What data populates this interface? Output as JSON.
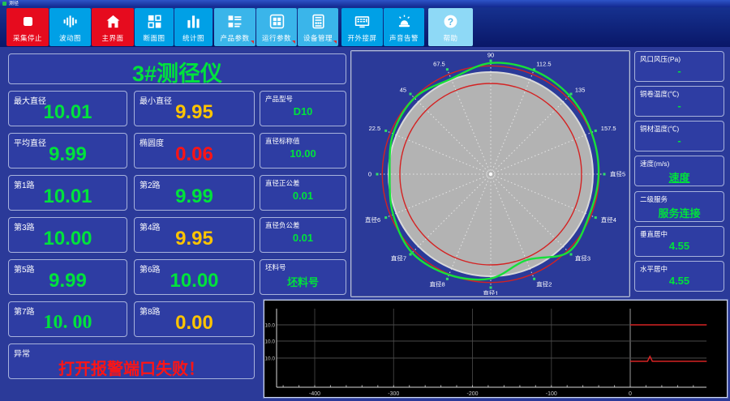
{
  "window": {
    "title": "测径"
  },
  "colors": {
    "accent_green": "#00e23c",
    "warn_yellow": "#ffc400",
    "alarm_red": "#ff1414",
    "button_red": "#e60b1e",
    "button_blue": "#00a0e6",
    "button_light": "#3ab5ea",
    "button_pale": "#8ed9f6",
    "profile_green": "#17e03a",
    "tolerance_red": "#d42222",
    "disc_gray": "#b3b3b3"
  },
  "toolbar": {
    "buttons": [
      {
        "label": "采集停止",
        "icon": "stop-icon",
        "style": "red",
        "corner": false
      },
      {
        "label": "波动图",
        "icon": "waveform-icon",
        "style": "blue",
        "corner": false
      },
      {
        "label": "主界面",
        "icon": "home-icon",
        "style": "red",
        "corner": false
      },
      {
        "label": "断面图",
        "icon": "sections-icon",
        "style": "blue",
        "corner": false
      },
      {
        "label": "统计图",
        "icon": "barchart-icon",
        "style": "blue",
        "corner": false
      },
      {
        "label": "产品参数",
        "icon": "product-params-icon",
        "style": "light",
        "corner": true
      },
      {
        "label": "运行参数",
        "icon": "run-params-icon",
        "style": "light",
        "corner": true
      },
      {
        "label": "设备管理",
        "icon": "device-manage-icon",
        "style": "light",
        "corner": true
      },
      {
        "label": "开外接屏",
        "icon": "external-screen-icon",
        "style": "blue",
        "corner": false
      },
      {
        "label": "声音告警",
        "icon": "sound-alarm-icon",
        "style": "blue",
        "corner": false
      },
      {
        "label": "帮助",
        "icon": "help-icon",
        "style": "pale",
        "corner": false
      }
    ]
  },
  "header": {
    "title": "3#测径仪"
  },
  "measurements": {
    "cells": [
      {
        "label": "最大直径",
        "value": "10.01",
        "color": "green",
        "col": "a",
        "row": 0
      },
      {
        "label": "最小直径",
        "value": "9.95",
        "color": "yellow",
        "col": "b",
        "row": 0
      },
      {
        "label": "产品型号",
        "value": "D10",
        "color": "green",
        "col": "c",
        "row": 0
      },
      {
        "label": "平均直径",
        "value": "9.99",
        "color": "green",
        "col": "a",
        "row": 1
      },
      {
        "label": "椭圆度",
        "value": "0.06",
        "color": "red",
        "col": "b",
        "row": 1
      },
      {
        "label": "直径标称值",
        "value": "10.00",
        "color": "green",
        "col": "c",
        "row": 1
      },
      {
        "label": "第1路",
        "value": "10.01",
        "color": "green",
        "col": "a",
        "row": 2
      },
      {
        "label": "第2路",
        "value": "9.99",
        "color": "green",
        "col": "b",
        "row": 2
      },
      {
        "label": "直径正公差",
        "value": "0.01",
        "color": "green",
        "col": "c",
        "row": 2
      },
      {
        "label": "第3路",
        "value": "10.00",
        "color": "green",
        "col": "a",
        "row": 3
      },
      {
        "label": "第4路",
        "value": "9.95",
        "color": "yellow",
        "col": "b",
        "row": 3
      },
      {
        "label": "直径负公差",
        "value": "0.01",
        "color": "green",
        "col": "c",
        "row": 3
      },
      {
        "label": "第5路",
        "value": "9.99",
        "color": "green",
        "col": "a",
        "row": 4
      },
      {
        "label": "第6路",
        "value": "10.00",
        "color": "green",
        "col": "b",
        "row": 4
      },
      {
        "label": "坯料号",
        "value": "坯料号",
        "color": "green",
        "col": "c",
        "row": 4
      },
      {
        "label": "第7路",
        "value": "10. 00",
        "color": "green",
        "col": "a",
        "row": 5,
        "serif": true
      },
      {
        "label": "第8路",
        "value": "0.00",
        "color": "yellow",
        "col": "b",
        "row": 5
      }
    ]
  },
  "alarm": {
    "label": "异常",
    "value": "打开报警端口失败！"
  },
  "right_panels": [
    {
      "label": "风口风压(Pa)",
      "value": "-",
      "underline": false
    },
    {
      "label": "铜卷温度(℃)",
      "value": "-",
      "underline": false
    },
    {
      "label": "铜材温度(℃)",
      "value": "-",
      "underline": false
    },
    {
      "label": "速度(m/s)",
      "value": "速度",
      "underline": true
    },
    {
      "label": "二级服务",
      "value": "服务连接",
      "underline": false
    },
    {
      "label": "垂直居中",
      "value": "4.55",
      "underline": false
    },
    {
      "label": "水平居中",
      "value": "4.55",
      "underline": false
    }
  ],
  "polar": {
    "type": "cross-section-profile",
    "nominal_diameter": 10.0,
    "path_values": [
      10.01,
      9.99,
      10.0,
      9.95,
      9.99,
      10.0,
      10.0,
      0.0
    ],
    "angle_labels": [
      "0",
      "22.5",
      "45",
      "67.5",
      "90",
      "112.5",
      "135",
      "157.5"
    ],
    "diameter_labels": [
      "直径1",
      "直径2",
      "直径3",
      "直径4",
      "直径5",
      "直径6",
      "直径7",
      "直径8"
    ],
    "spoke_labels": [
      "直径5",
      "157.5",
      "135",
      "112.5",
      "90",
      "67.5",
      "45",
      "22.5",
      "0",
      "直径6",
      "直径7",
      "直径8",
      "直径1",
      "直径2",
      "直径3",
      "直径4"
    ],
    "profile": [
      0.95,
      0.96,
      0.98,
      0.99,
      0.98,
      0.91,
      0.95,
      0.93,
      0.89,
      0.93,
      0.98,
      0.96,
      0.92,
      0.82,
      0.97,
      0.94
    ]
  },
  "trend": {
    "type": "line",
    "x_ticks": [
      "-400",
      "-300",
      "-200",
      "-100",
      "0"
    ],
    "y_labels": [
      "10.0",
      "10.0",
      "10.0"
    ],
    "red_segments": [
      {
        "level": "upper",
        "x_from": 0,
        "x_to": 97,
        "spike_x": null
      },
      {
        "level": "lower",
        "x_from": 0,
        "x_to": 97,
        "spike_x": 25
      }
    ]
  }
}
